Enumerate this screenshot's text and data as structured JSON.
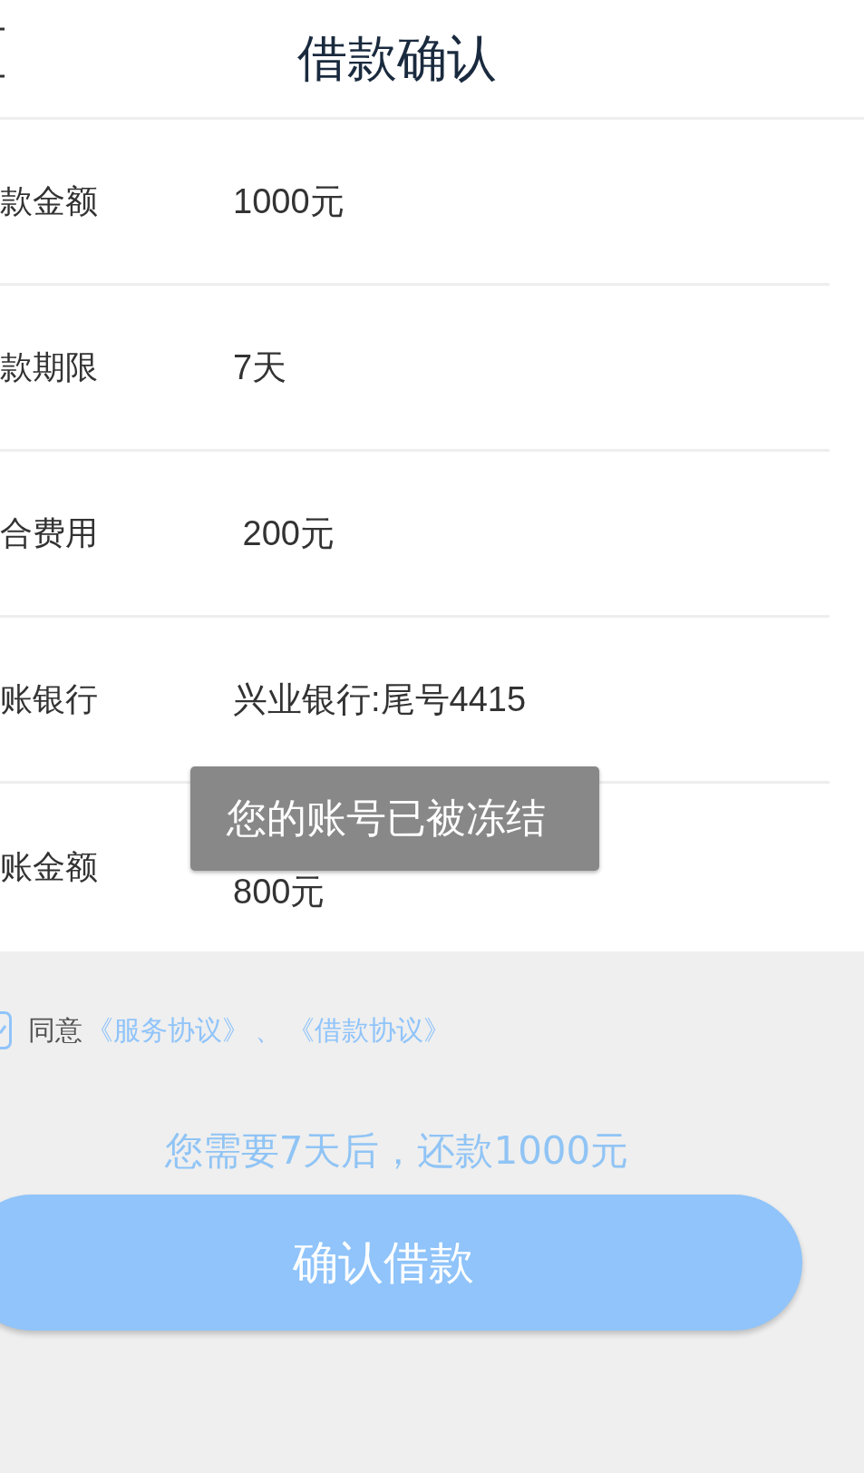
{
  "header": {
    "title": "借款确认"
  },
  "rows": [
    {
      "label": "款金额",
      "value": "1000元"
    },
    {
      "label": "款期限",
      "value": "7天"
    },
    {
      "label": "合费用",
      "value": " 200元"
    },
    {
      "label": "账银行",
      "value": "兴业银行:尾号4415"
    },
    {
      "label": "账金额",
      "value": "800元"
    }
  ],
  "agreement": {
    "checked": true,
    "prefix": "同意",
    "links": [
      "《服务协议》",
      "《借款协议》"
    ],
    "separator": "、"
  },
  "notice": "您需要7天后，还款1000元",
  "confirm_button": "确认借款",
  "toast": "您的账号已被冻结"
}
